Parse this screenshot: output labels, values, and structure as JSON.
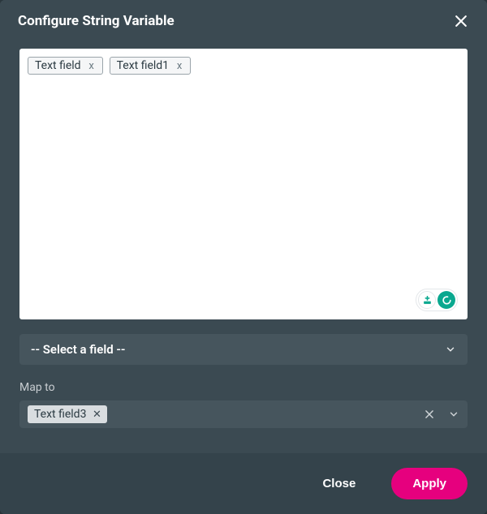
{
  "header": {
    "title": "Configure String Variable"
  },
  "editor": {
    "chips": [
      {
        "label": "Text field"
      },
      {
        "label": "Text field1"
      }
    ]
  },
  "select": {
    "placeholder": "-- Select a field --"
  },
  "mapTo": {
    "label": "Map to",
    "chip": {
      "label": "Text field3"
    }
  },
  "footer": {
    "close": "Close",
    "apply": "Apply"
  },
  "colors": {
    "accent": "#e6007e",
    "toolTeal": "#0aa88f"
  }
}
